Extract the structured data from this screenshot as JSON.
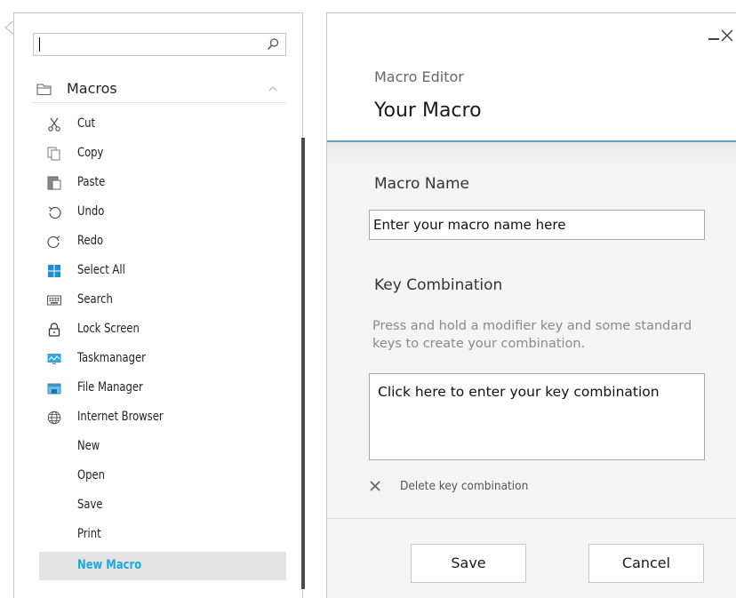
{
  "search": {
    "value": "",
    "placeholder": ""
  },
  "macro_list": {
    "group_label": "Macros",
    "items": [
      {
        "label": "Cut",
        "icon": "scissors-icon"
      },
      {
        "label": "Copy",
        "icon": "copy-icon"
      },
      {
        "label": "Paste",
        "icon": "paste-icon"
      },
      {
        "label": "Undo",
        "icon": "undo-icon"
      },
      {
        "label": "Redo",
        "icon": "redo-icon"
      },
      {
        "label": "Select All",
        "icon": "select-all-icon"
      },
      {
        "label": "Search",
        "icon": "keyboard-icon"
      },
      {
        "label": "Lock Screen",
        "icon": "lock-icon"
      },
      {
        "label": "Taskmanager",
        "icon": "monitor-chart-icon"
      },
      {
        "label": "File Manager",
        "icon": "file-manager-icon"
      },
      {
        "label": "Internet Browser",
        "icon": "globe-icon"
      },
      {
        "label": "New",
        "icon": ""
      },
      {
        "label": "Open",
        "icon": ""
      },
      {
        "label": "Save",
        "icon": ""
      },
      {
        "label": "Print",
        "icon": ""
      },
      {
        "label": "New Macro",
        "icon": "",
        "selected": true
      }
    ]
  },
  "editor": {
    "subtitle": "Macro Editor",
    "title": "Your Macro",
    "macro_name_label": "Macro Name",
    "macro_name_placeholder": "Enter your macro name here",
    "macro_name_value": "",
    "key_combination_label": "Key Combination",
    "key_combination_help": "Press and hold a modifier key and some standard keys to create your combination.",
    "key_combination_placeholder": "Click here to enter your key combination",
    "delete_label": "Delete key combination",
    "save_label": "Save",
    "cancel_label": "Cancel"
  },
  "colors": {
    "accent": "#1aa7e2",
    "header_line": "#5aa6cf",
    "selected_bg": "#e4e4e4"
  }
}
